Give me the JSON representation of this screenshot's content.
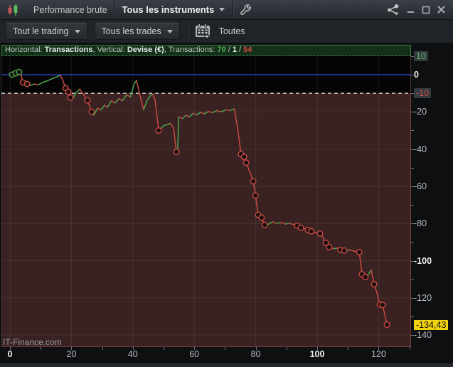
{
  "titlebar": {
    "tab_performance": "Performance brute",
    "instruments_dropdown": "Tous les instruments"
  },
  "toolbar": {
    "trading_dropdown": "Tout le trading",
    "trades_dropdown": "Tous les trades",
    "period_label": "Toutes"
  },
  "chart_header": {
    "horizontal_label": "Horizontal:",
    "horizontal_value": "Transactions",
    "sep1": ", ",
    "vertical_label": "Vertical:",
    "vertical_value": "Devise (€)",
    "sep2": ", ",
    "transactions_label": "Transactions:",
    "wins": "70",
    "slash1": " / ",
    "breakeven": "1",
    "slash2": " / ",
    "losses": "54"
  },
  "watermark": "IT-Finance.com",
  "colors": {
    "curve_green": "#49a84d",
    "curve_red": "#c94a42",
    "marker_fill": "#190d0d",
    "zero_line_blue": "#2f4cd8",
    "lower_dashed_white": "#ece4e4",
    "gain_zone_black": "#050505",
    "loss_zone_maroon": "#3a2222",
    "grid": "rgba(255,255,255,0.07)",
    "current_value_yellow": "#f2d40e",
    "header_green_bg": "#14301a",
    "header_green_border": "#3e7b42"
  },
  "chart_data": {
    "type": "line",
    "title": "Performance brute (cumulative P&L per transaction)",
    "xlabel": "Transactions",
    "ylabel": "Devise (€)",
    "x_range": [
      0,
      131
    ],
    "y_range": [
      15.8,
      -146.7
    ],
    "grid": true,
    "x_axis": {
      "labels": [
        {
          "x": 0,
          "text": "0",
          "cls": "x-bold"
        },
        {
          "x": 20,
          "text": "20",
          "cls": ""
        },
        {
          "x": 40,
          "text": "40",
          "cls": ""
        },
        {
          "x": 60,
          "text": "60",
          "cls": ""
        },
        {
          "x": 80,
          "text": "80",
          "cls": ""
        },
        {
          "x": 100,
          "text": "100",
          "cls": "x-bold"
        },
        {
          "x": 120,
          "text": "120",
          "cls": ""
        }
      ],
      "grid_at": [
        0,
        20,
        40,
        60,
        80,
        100,
        120
      ],
      "minor_ticks": [
        0,
        10,
        20,
        30,
        40,
        50,
        60,
        70,
        80,
        90,
        100,
        110,
        120,
        130
      ]
    },
    "y_axis": {
      "labels": [
        {
          "v": 10,
          "text": "10",
          "cls": "y-pos"
        },
        {
          "v": 0,
          "text": "0",
          "cls": "y-zero"
        },
        {
          "v": -10,
          "text": "-10",
          "cls": "y-neg"
        },
        {
          "v": -20,
          "text": "-20",
          "cls": "y-dim"
        },
        {
          "v": -40,
          "text": "-40",
          "cls": "y-dim"
        },
        {
          "v": -60,
          "text": "-60",
          "cls": "y-dim"
        },
        {
          "v": -80,
          "text": "-80",
          "cls": "y-dim"
        },
        {
          "v": -100,
          "text": "-100",
          "cls": "y-bold"
        },
        {
          "v": -120,
          "text": "-120",
          "cls": "y-dim"
        },
        {
          "v": -134.43,
          "text": "-134,43",
          "cls": "y-cur"
        },
        {
          "v": -140,
          "text": "-140",
          "cls": "y-dim"
        }
      ],
      "grid_at": [
        -20,
        -40,
        -60,
        -80,
        -100,
        -120,
        -140
      ],
      "minor_ticks": [
        10,
        0,
        -10,
        -20,
        -30,
        -40,
        -50,
        -60,
        -70,
        -80,
        -90,
        -100,
        -110,
        -120,
        -130,
        -140
      ]
    },
    "reference_lines": {
      "upper_dashed_green": 10,
      "zero_blue": 0,
      "lower_dashed_white": -10
    },
    "stats": {
      "winning_trades": 70,
      "breakeven_trades": 1,
      "losing_trades": 54
    },
    "current_value": -134.43,
    "points": [
      [
        0,
        0.3
      ],
      [
        0.7,
        0
      ],
      [
        1.9,
        0.8
      ],
      [
        3,
        1.5
      ],
      [
        3.6,
        0.6
      ],
      [
        4.2,
        -4.2
      ],
      [
        5.6,
        -5
      ],
      [
        6.5,
        -5.8
      ],
      [
        8,
        -5
      ],
      [
        9.2,
        -5.5
      ],
      [
        10.5,
        -4.3
      ],
      [
        12,
        -3.4
      ],
      [
        13.5,
        -2.3
      ],
      [
        15,
        -1.3
      ],
      [
        16.4,
        -0.3
      ],
      [
        17.2,
        -3
      ],
      [
        18.1,
        -7.3
      ],
      [
        19,
        -9.2
      ],
      [
        19.7,
        -12.3
      ],
      [
        20.3,
        -13.2
      ],
      [
        21.5,
        -9.8
      ],
      [
        22.7,
        -7.7
      ],
      [
        24,
        -10.8
      ],
      [
        25.2,
        -13.8
      ],
      [
        26.6,
        -20
      ],
      [
        27.3,
        -21.8
      ],
      [
        28.5,
        -18
      ],
      [
        29.6,
        -19
      ],
      [
        30.8,
        -16.5
      ],
      [
        31.8,
        -17.5
      ],
      [
        33,
        -14
      ],
      [
        34.2,
        -15.2
      ],
      [
        35.5,
        -12.8
      ],
      [
        36.6,
        -14
      ],
      [
        38,
        -10.8
      ],
      [
        39.2,
        -12
      ],
      [
        40.4,
        -5
      ],
      [
        41.2,
        -3.1
      ],
      [
        42.3,
        -11
      ],
      [
        43.5,
        -18.8
      ],
      [
        44.6,
        -14
      ],
      [
        45.6,
        -11.5
      ],
      [
        46.5,
        -10.4
      ],
      [
        47.3,
        -14
      ],
      [
        48.4,
        -30
      ],
      [
        50,
        -27.5
      ],
      [
        52.3,
        -26.2
      ],
      [
        53.2,
        -28.5
      ],
      [
        54.2,
        -41.5
      ],
      [
        54.6,
        -41
      ],
      [
        54.9,
        -22.7
      ],
      [
        56.2,
        -23.6
      ],
      [
        57.3,
        -21.8
      ],
      [
        58.4,
        -22.6
      ],
      [
        59.6,
        -20.8
      ],
      [
        60.8,
        -21.6
      ],
      [
        62,
        -20.3
      ],
      [
        63.2,
        -21
      ],
      [
        64.6,
        -19.8
      ],
      [
        66,
        -20.4
      ],
      [
        67.4,
        -19.3
      ],
      [
        68.8,
        -19.9
      ],
      [
        70.2,
        -18.9
      ],
      [
        71.6,
        -19.2
      ],
      [
        73.1,
        -18.4
      ],
      [
        74.2,
        -30
      ],
      [
        75.2,
        -42.7
      ],
      [
        76.2,
        -44.2
      ],
      [
        76.9,
        -47.3
      ],
      [
        78,
        -52
      ],
      [
        79.2,
        -57.3
      ],
      [
        79.9,
        -65
      ],
      [
        80.8,
        -75.4
      ],
      [
        81.9,
        -76.9
      ],
      [
        82.9,
        -80.8
      ],
      [
        84.2,
        -80.3
      ],
      [
        85.5,
        -79.1
      ],
      [
        86.8,
        -80
      ],
      [
        88.2,
        -79.5
      ],
      [
        89.6,
        -80.3
      ],
      [
        91,
        -79.9
      ],
      [
        92.3,
        -80.6
      ],
      [
        93.5,
        -81.2
      ],
      [
        94.7,
        -82.3
      ],
      [
        96,
        -82.8
      ],
      [
        97,
        -83.5
      ],
      [
        98.1,
        -84.2
      ],
      [
        99.5,
        -84.8
      ],
      [
        100.9,
        -85.4
      ],
      [
        101.9,
        -87.5
      ],
      [
        102.8,
        -90.4
      ],
      [
        103.9,
        -92.7
      ],
      [
        105.5,
        -93.6
      ],
      [
        106.5,
        -93.2
      ],
      [
        107.6,
        -94.2
      ],
      [
        108.8,
        -94.6
      ],
      [
        110.4,
        -94.2
      ],
      [
        112,
        -94.9
      ],
      [
        113.7,
        -95.4
      ],
      [
        114.6,
        -107.3
      ],
      [
        115.7,
        -108.8
      ],
      [
        116.6,
        -107.5
      ],
      [
        117.6,
        -105
      ],
      [
        118.5,
        -112.7
      ],
      [
        119.4,
        -117
      ],
      [
        120.4,
        -123.5
      ],
      [
        121.3,
        -123.8
      ],
      [
        122.7,
        -134.43
      ]
    ],
    "markers": [
      [
        0.7,
        0,
        "g"
      ],
      [
        1.9,
        0.8,
        "g"
      ],
      [
        3,
        1.5,
        "g"
      ],
      [
        4.2,
        -4.2,
        "r"
      ],
      [
        5.6,
        -5,
        "r"
      ],
      [
        18.1,
        -7.3,
        "r"
      ],
      [
        19,
        -9.2,
        "r"
      ],
      [
        19.7,
        -12.3,
        "r"
      ],
      [
        25.2,
        -13.8,
        "r"
      ],
      [
        26.6,
        -20,
        "r"
      ],
      [
        48.4,
        -30,
        "r"
      ],
      [
        54.2,
        -41.5,
        "r"
      ],
      [
        75.2,
        -42.7,
        "r"
      ],
      [
        76.2,
        -44.2,
        "r"
      ],
      [
        76.9,
        -47.3,
        "r"
      ],
      [
        79.2,
        -57.3,
        "r"
      ],
      [
        79.9,
        -65,
        "r"
      ],
      [
        80.8,
        -75.4,
        "r"
      ],
      [
        81.9,
        -76.9,
        "r"
      ],
      [
        82.9,
        -80.8,
        "r"
      ],
      [
        93.5,
        -81.2,
        "r"
      ],
      [
        94.7,
        -82.3,
        "r"
      ],
      [
        97,
        -83.5,
        "r"
      ],
      [
        98.1,
        -84.2,
        "r"
      ],
      [
        100.9,
        -85.4,
        "r"
      ],
      [
        102.8,
        -90.4,
        "r"
      ],
      [
        103.9,
        -92.7,
        "r"
      ],
      [
        107.6,
        -94.2,
        "r"
      ],
      [
        108.8,
        -94.6,
        "r"
      ],
      [
        113.7,
        -95.4,
        "r"
      ],
      [
        114.6,
        -107.3,
        "r"
      ],
      [
        115.7,
        -108.8,
        "r"
      ],
      [
        118.5,
        -112.7,
        "r"
      ],
      [
        120.4,
        -123.5,
        "r"
      ],
      [
        121.3,
        -123.8,
        "r"
      ],
      [
        122.7,
        -134.43,
        "r"
      ]
    ]
  }
}
